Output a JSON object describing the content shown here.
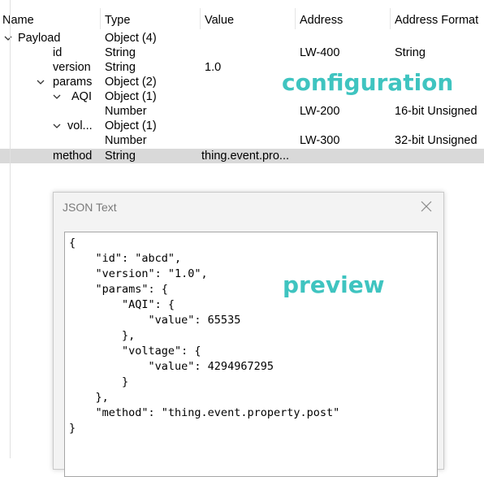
{
  "header": {
    "name": "Name",
    "type": "Type",
    "value": "Value",
    "address": "Address",
    "address_format": "Address Format"
  },
  "rows": [
    {
      "name": "Payload",
      "type": "Object (4)",
      "value": "",
      "address": "",
      "format": "",
      "expander": "expanded"
    },
    {
      "name": "id",
      "type": "String",
      "value": "",
      "address": "LW-400",
      "format": "String",
      "expander": ""
    },
    {
      "name": "version",
      "type": "String",
      "value": "1.0",
      "address": "",
      "format": "",
      "expander": ""
    },
    {
      "name": "params",
      "type": "Object (2)",
      "value": "",
      "address": "",
      "format": "",
      "expander": "expanded"
    },
    {
      "name": "AQI",
      "type": "Object (1)",
      "value": "",
      "address": "",
      "format": "",
      "expander": "expanded"
    },
    {
      "name": "",
      "type": "Number",
      "value": "",
      "address": "LW-200",
      "format": "16-bit Unsigned",
      "expander": ""
    },
    {
      "name": "vol...",
      "type": "Object (1)",
      "value": "",
      "address": "",
      "format": "",
      "expander": "expanded"
    },
    {
      "name": "",
      "type": "Number",
      "value": "",
      "address": "LW-300",
      "format": "32-bit Unsigned",
      "expander": ""
    },
    {
      "name": "method",
      "type": "String",
      "value": "thing.event.pro...",
      "address": "",
      "format": "",
      "expander": ""
    }
  ],
  "annotations": {
    "configuration": "configuration",
    "preview": "preview"
  },
  "dialog": {
    "title": "JSON Text",
    "close_glyph": "✕",
    "json_text": "{\n    \"id\": \"abcd\",\n    \"version\": \"1.0\",\n    \"params\": {\n        \"AQI\": {\n            \"value\": 65535\n        },\n        \"voltage\": {\n            \"value\": 4294967295\n        }\n    },\n    \"method\": \"thing.event.property.post\"\n}"
  },
  "icons": {
    "expand": "chevron-down-icon",
    "close": "close-icon"
  },
  "colors": {
    "annotation": "#3fc4c0",
    "selected_row": "#d9d9d9"
  }
}
